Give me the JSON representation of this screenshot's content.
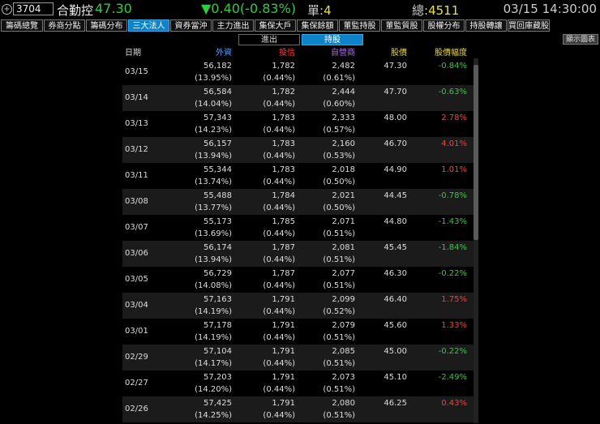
{
  "header": {
    "code": "3704",
    "name": "合勤控",
    "price": "47.30",
    "change": "▼0.40(-0.83%)",
    "unit_label": "單:",
    "unit_value": "4",
    "total_label": "總:",
    "total_value": "4511",
    "datetime": "03/15 14:30:00"
  },
  "tabs": [
    "籌碼總覽",
    "券商分點",
    "籌碼分布",
    "三大法人",
    "資券當沖",
    "主力進出",
    "集保大戶",
    "集保餘額",
    "董監持股",
    "董監質股",
    "股權分布",
    "持股轉讓",
    "買回庫藏股"
  ],
  "active_tab": "三大法人",
  "subtabs": [
    "進出",
    "持股"
  ],
  "active_subtab": "持股",
  "chart_button": "顯示圖表",
  "columns": [
    "日期",
    "外資",
    "投信",
    "自營商",
    "股價",
    "股價幅度"
  ],
  "colors": {
    "up": "#ff3b3b",
    "down": "#2ecc40",
    "foreign": "#4aa3ff",
    "trust": "#ff4040",
    "dealer": "#b06cf2",
    "price_hdr": "#e8d33a"
  },
  "rows": [
    {
      "date": "03/15",
      "f": "56,182",
      "fp": "(13.95%)",
      "t": "1,782",
      "tp": "(0.44%)",
      "d": "2,482",
      "dp": "(0.61%)",
      "price": "47.30",
      "pct": "-0.84%",
      "dir": "down"
    },
    {
      "date": "03/14",
      "f": "56,584",
      "fp": "(14.04%)",
      "t": "1,782",
      "tp": "(0.44%)",
      "d": "2,444",
      "dp": "(0.60%)",
      "price": "47.70",
      "pct": "-0.63%",
      "dir": "down"
    },
    {
      "date": "03/13",
      "f": "57,343",
      "fp": "(14.23%)",
      "t": "1,783",
      "tp": "(0.44%)",
      "d": "2,333",
      "dp": "(0.57%)",
      "price": "48.00",
      "pct": "2.78%",
      "dir": "up"
    },
    {
      "date": "03/12",
      "f": "56,157",
      "fp": "(13.94%)",
      "t": "1,783",
      "tp": "(0.44%)",
      "d": "2,160",
      "dp": "(0.53%)",
      "price": "46.70",
      "pct": "4.01%",
      "dir": "up"
    },
    {
      "date": "03/11",
      "f": "55,344",
      "fp": "(13.74%)",
      "t": "1,783",
      "tp": "(0.44%)",
      "d": "2,018",
      "dp": "(0.50%)",
      "price": "44.90",
      "pct": "1.01%",
      "dir": "up"
    },
    {
      "date": "03/08",
      "f": "55,488",
      "fp": "(13.77%)",
      "t": "1,784",
      "tp": "(0.44%)",
      "d": "2,021",
      "dp": "(0.50%)",
      "price": "44.45",
      "pct": "-0.78%",
      "dir": "down"
    },
    {
      "date": "03/07",
      "f": "55,173",
      "fp": "(13.69%)",
      "t": "1,785",
      "tp": "(0.44%)",
      "d": "2,071",
      "dp": "(0.51%)",
      "price": "44.80",
      "pct": "-1.43%",
      "dir": "down"
    },
    {
      "date": "03/06",
      "f": "56,174",
      "fp": "(13.94%)",
      "t": "1,787",
      "tp": "(0.44%)",
      "d": "2,081",
      "dp": "(0.51%)",
      "price": "45.45",
      "pct": "-1.84%",
      "dir": "down"
    },
    {
      "date": "03/05",
      "f": "56,729",
      "fp": "(14.08%)",
      "t": "1,787",
      "tp": "(0.44%)",
      "d": "2,077",
      "dp": "(0.51%)",
      "price": "46.30",
      "pct": "-0.22%",
      "dir": "down"
    },
    {
      "date": "03/04",
      "f": "57,163",
      "fp": "(14.19%)",
      "t": "1,791",
      "tp": "(0.44%)",
      "d": "2,099",
      "dp": "(0.52%)",
      "price": "46.40",
      "pct": "1.75%",
      "dir": "up"
    },
    {
      "date": "03/01",
      "f": "57,178",
      "fp": "(14.19%)",
      "t": "1,791",
      "tp": "(0.44%)",
      "d": "2,079",
      "dp": "(0.51%)",
      "price": "45.60",
      "pct": "1.33%",
      "dir": "up"
    },
    {
      "date": "02/29",
      "f": "57,104",
      "fp": "(14.17%)",
      "t": "1,791",
      "tp": "(0.44%)",
      "d": "2,085",
      "dp": "(0.51%)",
      "price": "45.00",
      "pct": "-0.22%",
      "dir": "down"
    },
    {
      "date": "02/27",
      "f": "57,203",
      "fp": "(14.20%)",
      "t": "1,791",
      "tp": "(0.44%)",
      "d": "2,073",
      "dp": "(0.51%)",
      "price": "45.10",
      "pct": "-2.49%",
      "dir": "down"
    },
    {
      "date": "02/26",
      "f": "57,425",
      "fp": "(14.25%)",
      "t": "1,791",
      "tp": "(0.44%)",
      "d": "2,080",
      "dp": "(0.51%)",
      "price": "46.25",
      "pct": "0.43%",
      "dir": "up"
    }
  ]
}
